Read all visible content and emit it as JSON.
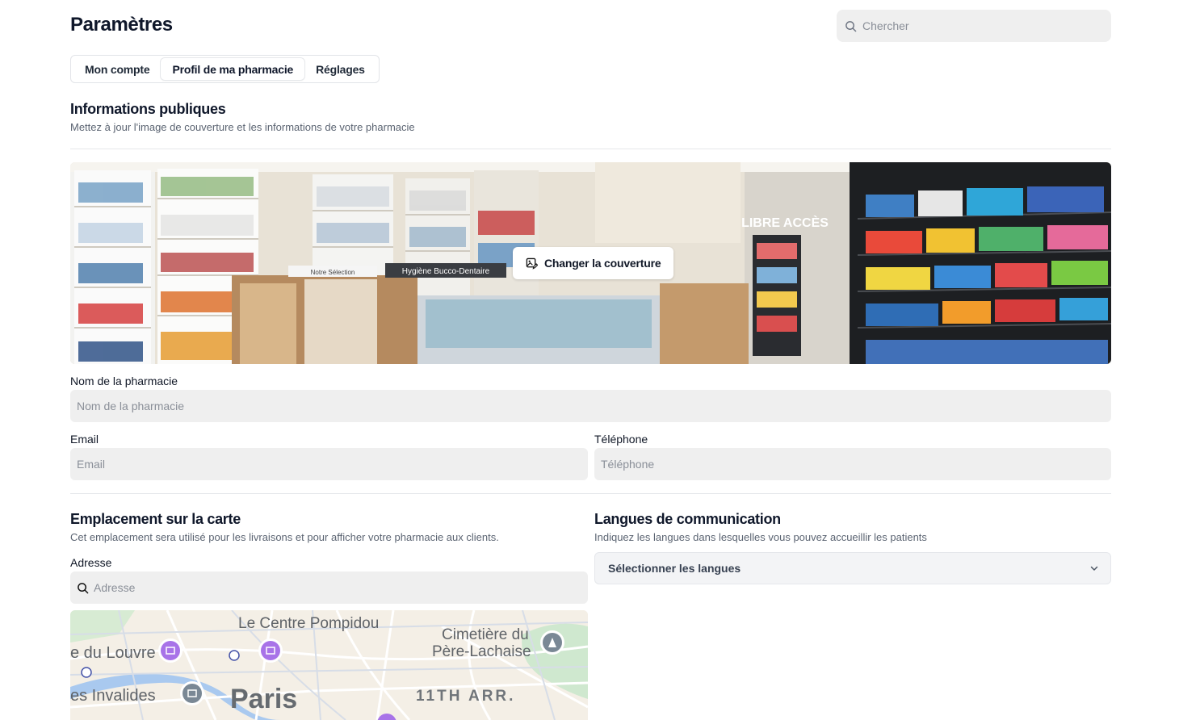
{
  "page": {
    "title": "Paramètres"
  },
  "search": {
    "placeholder": "Chercher"
  },
  "tabs": [
    {
      "label": "Mon compte",
      "active": false
    },
    {
      "label": "Profil de ma pharmacie",
      "active": true
    },
    {
      "label": "Réglages",
      "active": false
    }
  ],
  "public_info": {
    "title": "Informations publiques",
    "subtitle": "Mettez à jour l'image de couverture et les informations de votre pharmacie",
    "cover_button": "Changer la couverture",
    "cover_signs": {
      "sign1": "Hygiène Bucco-Dentaire",
      "sign2": "Notre Sélection",
      "sign3": "LIBRE ACCÈS"
    }
  },
  "form": {
    "name": {
      "label": "Nom de la pharmacie",
      "placeholder": "Nom de la pharmacie",
      "value": ""
    },
    "email": {
      "label": "Email",
      "placeholder": "Email",
      "value": ""
    },
    "phone": {
      "label": "Téléphone",
      "placeholder": "Téléphone",
      "value": ""
    }
  },
  "location": {
    "title": "Emplacement sur la carte",
    "subtitle": "Cet emplacement sera utilisé pour les livraisons et pour afficher votre pharmacie aux clients.",
    "address_label": "Adresse",
    "address_placeholder": "Adresse",
    "map_labels": {
      "pompidou": "Le Centre Pompidou",
      "louvre": "e du Louvre",
      "invalides": "es Invalides",
      "paris": "Paris",
      "cemetery_1": "Cimetière du",
      "cemetery_2": "Père-Lachaise",
      "arr": "11TH ARR."
    }
  },
  "languages": {
    "title": "Langues de communication",
    "subtitle": "Indiquez les langues dans lesquelles vous pouvez accueillir les patients",
    "select_placeholder": "Sélectionner les langues"
  },
  "colors": {
    "field_bg": "#efefef",
    "divider": "#e5e7eb",
    "map_poi_purple": "#a873e8",
    "map_poi_grey": "#7a8895"
  },
  "icons": {
    "search": "search-icon",
    "image_edit": "image-edit-icon",
    "chevron": "chevron-down-icon"
  }
}
